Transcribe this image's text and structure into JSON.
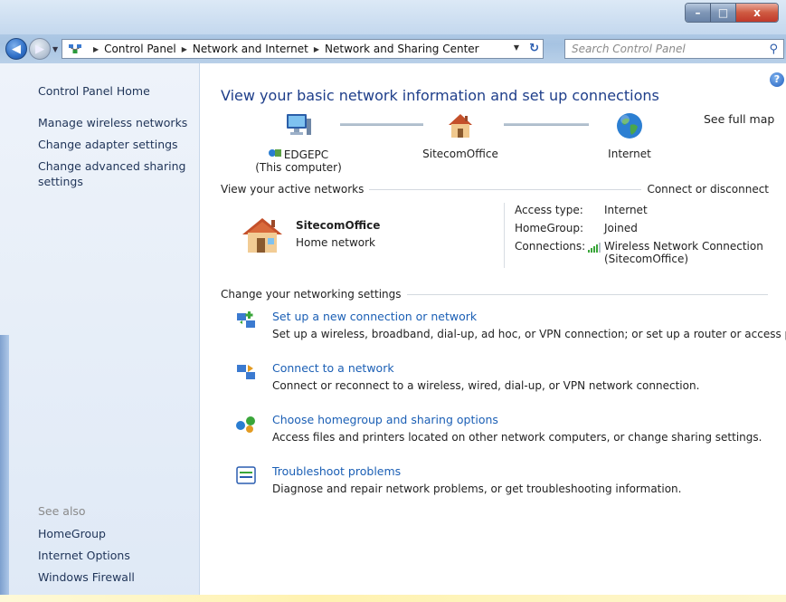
{
  "window": {
    "minimize_glyph": "–",
    "maximize_glyph": "□",
    "close_glyph": "x"
  },
  "address_bar": {
    "breadcrumbs": [
      "Control Panel",
      "Network and Internet",
      "Network and Sharing Center"
    ],
    "search_placeholder": "Search Control Panel"
  },
  "sidebar": {
    "home": "Control Panel Home",
    "items": [
      "Manage wireless networks",
      "Change adapter settings",
      "Change advanced sharing settings"
    ],
    "see_also_title": "See also",
    "see_also": [
      "HomeGroup",
      "Internet Options",
      "Windows Firewall"
    ]
  },
  "main": {
    "title": "View your basic network information and set up connections",
    "see_full_map": "See full map",
    "map": {
      "computer_name": "EDGEPC",
      "computer_sub": "(This computer)",
      "network_name": "SitecomOffice",
      "internet": "Internet"
    },
    "active_networks": {
      "label": "View your active networks",
      "connect_link": "Connect or disconnect",
      "network_name": "SitecomOffice",
      "network_type": "Home network",
      "access_type_label": "Access type:",
      "access_type_value": "Internet",
      "homegroup_label": "HomeGroup:",
      "homegroup_value": "Joined",
      "connections_label": "Connections:",
      "connection_name": "Wireless Network Connection",
      "connection_sub": "(SitecomOffice)"
    },
    "settings": {
      "label": "Change your networking settings",
      "tasks": [
        {
          "title": "Set up a new connection or network",
          "desc": "Set up a wireless, broadband, dial-up, ad hoc, or VPN connection; or set up a router or access point.",
          "icon": "new-connection-icon"
        },
        {
          "title": "Connect to a network",
          "desc": "Connect or reconnect to a wireless, wired, dial-up, or VPN network connection.",
          "icon": "connect-network-icon"
        },
        {
          "title": "Choose homegroup and sharing options",
          "desc": "Access files and printers located on other network computers, or change sharing settings.",
          "icon": "homegroup-icon"
        },
        {
          "title": "Troubleshoot problems",
          "desc": "Diagnose and repair network problems, or get troubleshooting information.",
          "icon": "troubleshoot-icon"
        }
      ]
    }
  }
}
